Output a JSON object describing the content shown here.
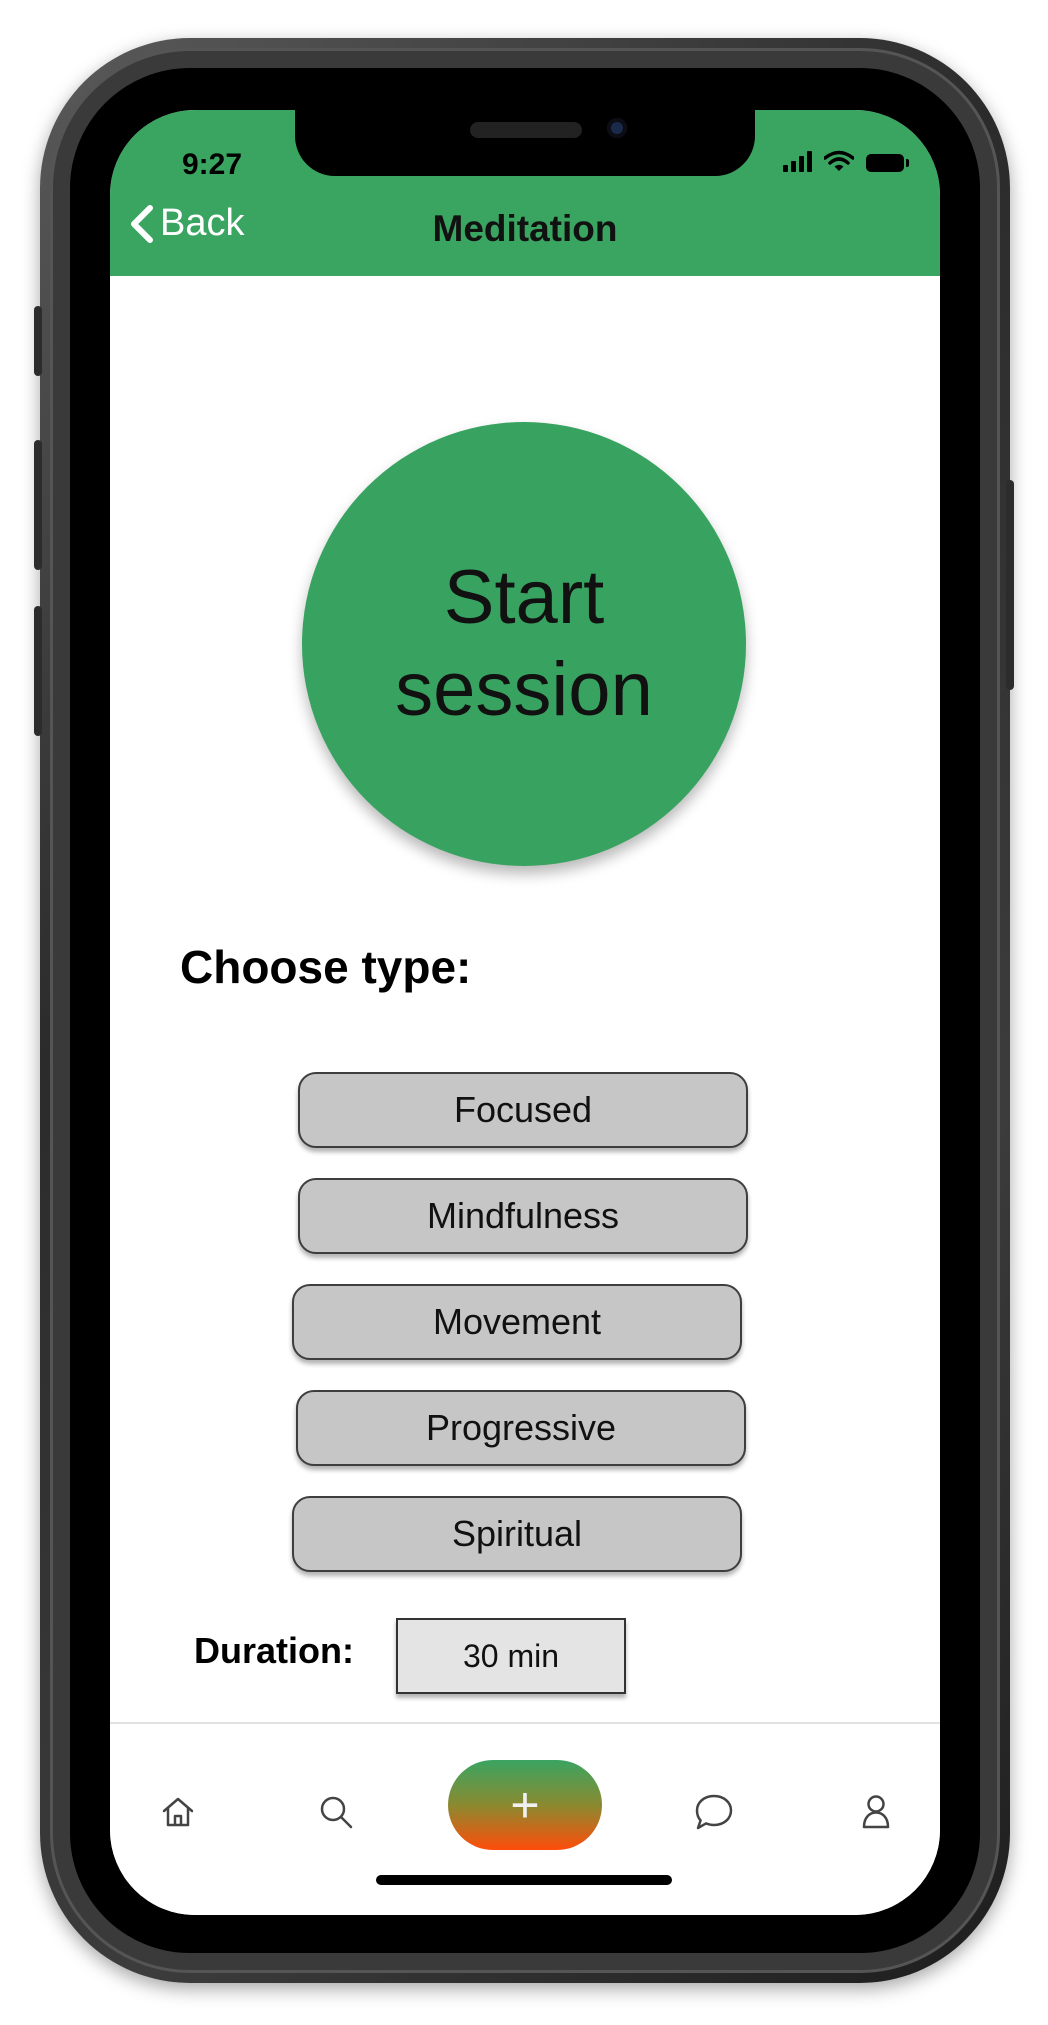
{
  "status_bar": {
    "time": "9:27"
  },
  "header": {
    "back_label": "Back",
    "title": "Meditation"
  },
  "main": {
    "start_label": "Start session",
    "choose_type_label": "Choose type:",
    "types": [
      "Focused",
      "Mindfulness",
      "Movement",
      "Progressive",
      "Spiritual"
    ],
    "duration_label": "Duration:",
    "duration_value": "30 min"
  },
  "tabbar": {
    "items": [
      "home-icon",
      "search-icon",
      "add-icon",
      "chat-icon",
      "profile-icon"
    ],
    "fab_symbol": "+"
  },
  "colors": {
    "brand_green": "#3aa461",
    "fab_gradient_end": "#ff4d0a",
    "type_button_bg": "#c6c6c6"
  }
}
